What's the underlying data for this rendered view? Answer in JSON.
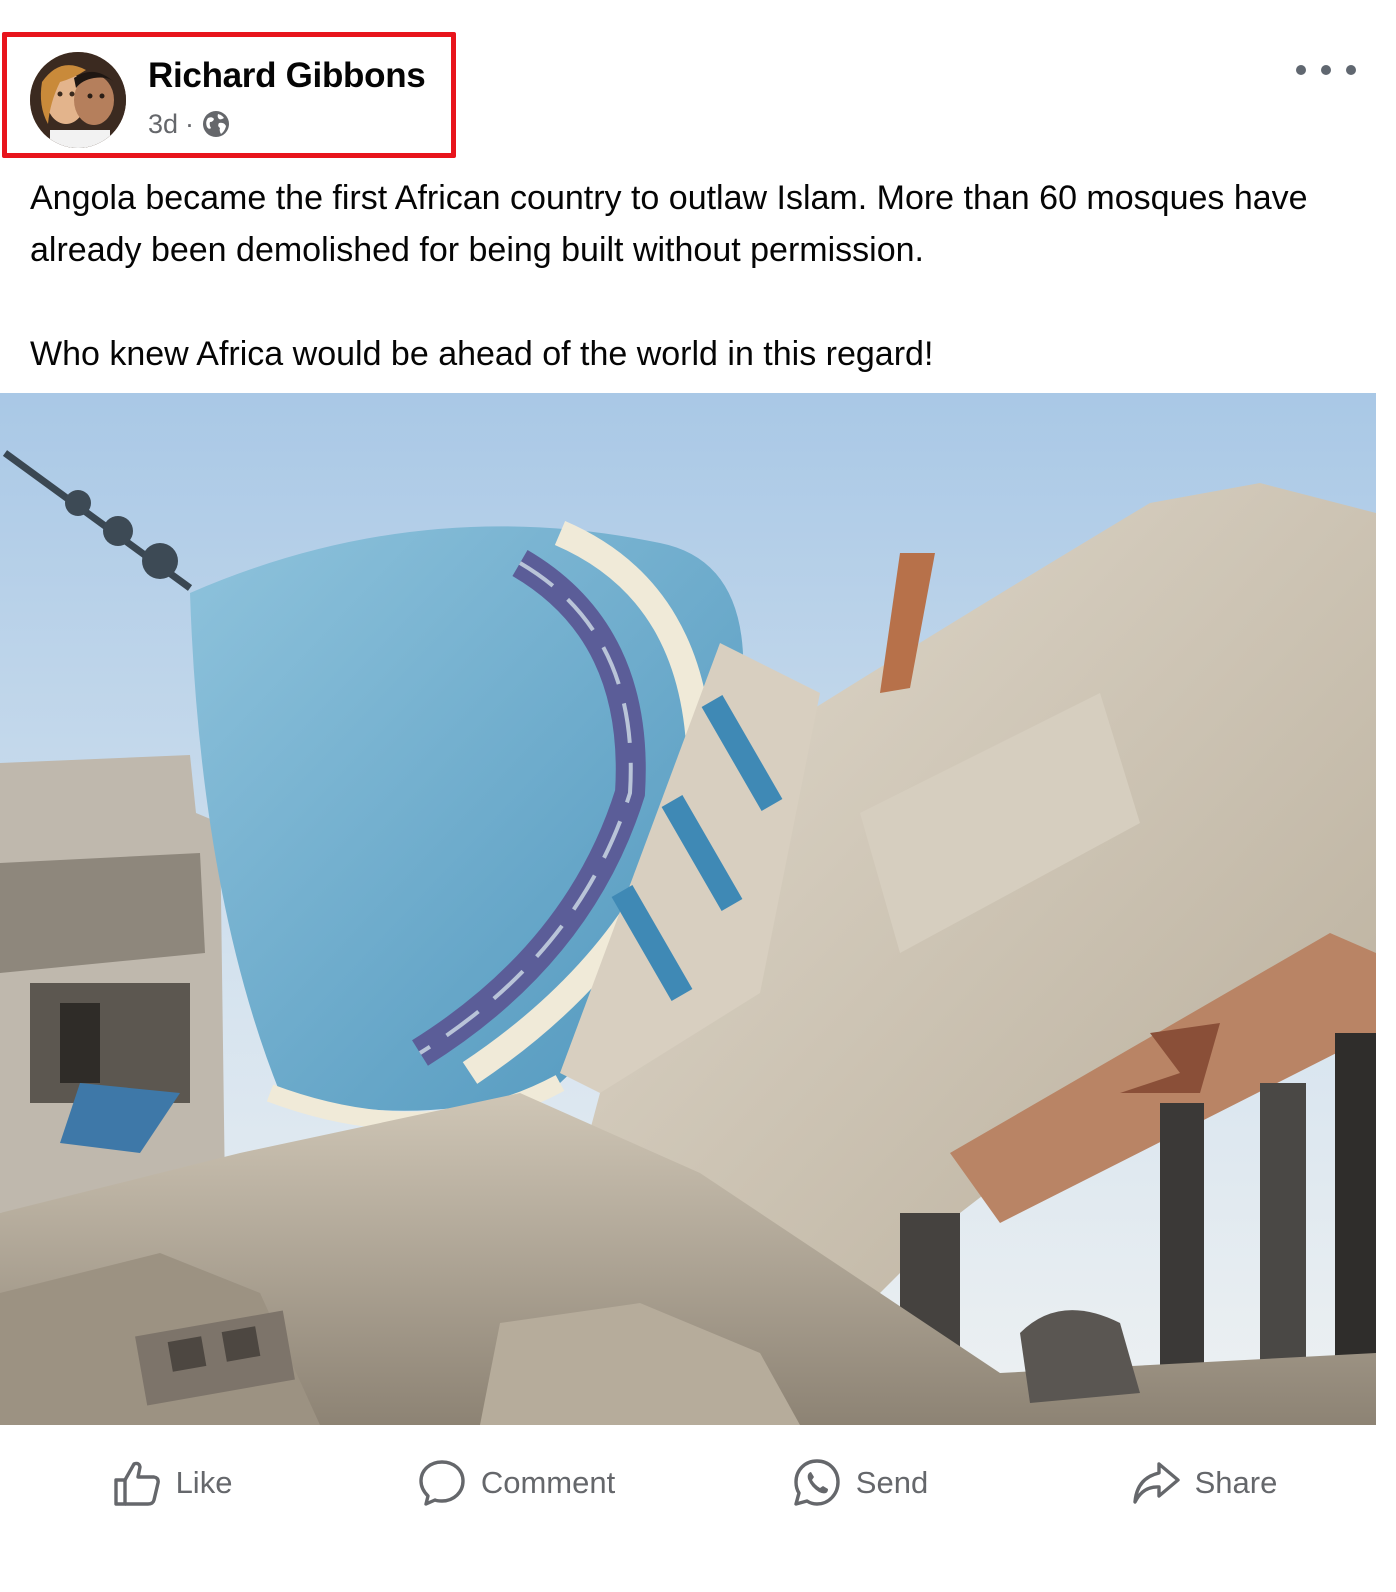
{
  "post": {
    "author": "Richard Gibbons",
    "time": "3d",
    "separator": "·",
    "audience_icon": "globe-icon",
    "more_icon": "more-options-icon",
    "highlight_color": "#e8141c",
    "text_paragraphs": [
      "Angola became the first African country to outlaw Islam. More than 60 mosques have already been demolished for being built without permission.",
      "Who knew Africa would be ahead of the world in this regard!"
    ]
  },
  "actions": [
    {
      "label": "Like",
      "icon": "thumbs-up-icon"
    },
    {
      "label": "Comment",
      "icon": "comment-bubble-icon"
    },
    {
      "label": "Send",
      "icon": "whatsapp-send-icon"
    },
    {
      "label": "Share",
      "icon": "share-arrow-icon"
    }
  ],
  "colors": {
    "text": "#050505",
    "secondary_text": "#65676b",
    "background": "#ffffff"
  }
}
